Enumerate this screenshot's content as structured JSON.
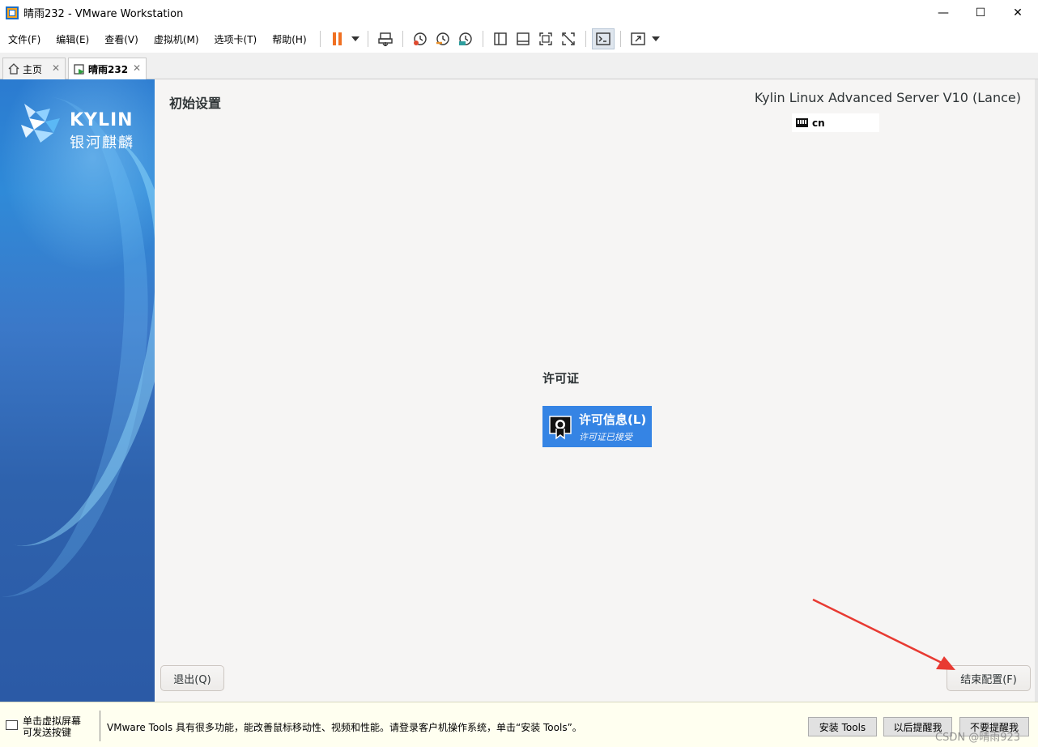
{
  "window": {
    "title": "晴雨232 - VMware Workstation",
    "min_glyph": "—",
    "max_glyph": "☐",
    "close_glyph": "✕"
  },
  "menu": {
    "items": [
      "文件(F)",
      "编辑(E)",
      "查看(V)",
      "虚拟机(M)",
      "选项卡(T)",
      "帮助(H)"
    ]
  },
  "toolbar": {
    "icons": [
      "pause-icon",
      "dropdown-icon",
      "send-ctrl-alt-del-icon",
      "snapshot-icon",
      "revert-snapshot-icon",
      "snapshot-manager-icon",
      "show-library-icon",
      "thumbnail-bar-icon",
      "full-screen-icon",
      "unity-icon",
      "console-view-icon",
      "stretch-guest-icon"
    ]
  },
  "tabs": [
    {
      "label": "主页",
      "icon": "home-icon",
      "active": false
    },
    {
      "label": "晴雨232",
      "icon": "vm-running-icon",
      "active": true
    }
  ],
  "installer": {
    "brand_text": "KYLIN",
    "brand_sub": "银河麒麟",
    "spoke_title": "初始设置",
    "os_name": "Kylin Linux Advanced Server V10 (Lance)",
    "keyboard_layout": "cn",
    "category_title": "许可证",
    "license_spoke": {
      "label": "许可信息(L)",
      "status": "许可证已接受"
    },
    "quit_label": "退出(Q)",
    "finish_label": "结束配置(F)"
  },
  "statusbar": {
    "hint_line1": "单击虚拟屏幕",
    "hint_line2": "可发送按键",
    "tools_message": "VMware Tools 具有很多功能，能改善鼠标移动性、视频和性能。请登录客户机操作系统，单击“安装 Tools”。",
    "install_tools": "安装 Tools",
    "remind_later": "以后提醒我",
    "never_remind": "不要提醒我",
    "watermark": "CSDN @晴雨923"
  },
  "colors": {
    "accent": "#3584e4",
    "annotation_arrow": "#e83a32",
    "pause": "#f07022"
  }
}
